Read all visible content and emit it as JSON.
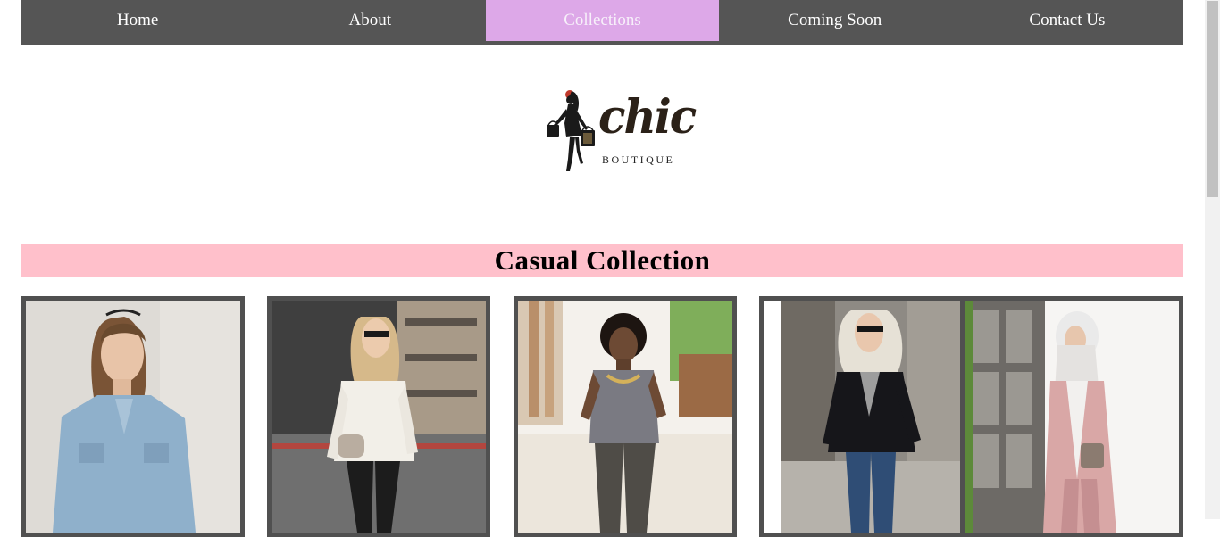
{
  "nav": {
    "items": [
      {
        "label": "Home",
        "name": "nav-home"
      },
      {
        "label": "About",
        "name": "nav-about"
      },
      {
        "label": "Collections",
        "name": "nav-collections",
        "active": true
      },
      {
        "label": "Coming Soon",
        "name": "nav-coming-soon"
      },
      {
        "label": "Contact Us",
        "name": "nav-contact-us"
      }
    ],
    "active_color": "#dda8e8",
    "bar_color": "#555555"
  },
  "logo": {
    "word": "chic",
    "sub": "BOUTIQUE"
  },
  "section": {
    "title": "Casual Collection",
    "banner_color": "#ffc0cb"
  },
  "gallery": {
    "items": [
      {
        "name": "photo-denim-jacket"
      },
      {
        "name": "photo-white-sweater"
      },
      {
        "name": "photo-grey-tee"
      },
      {
        "name": "photo-black-blazer"
      },
      {
        "name": "photo-pink-outfit"
      }
    ]
  }
}
